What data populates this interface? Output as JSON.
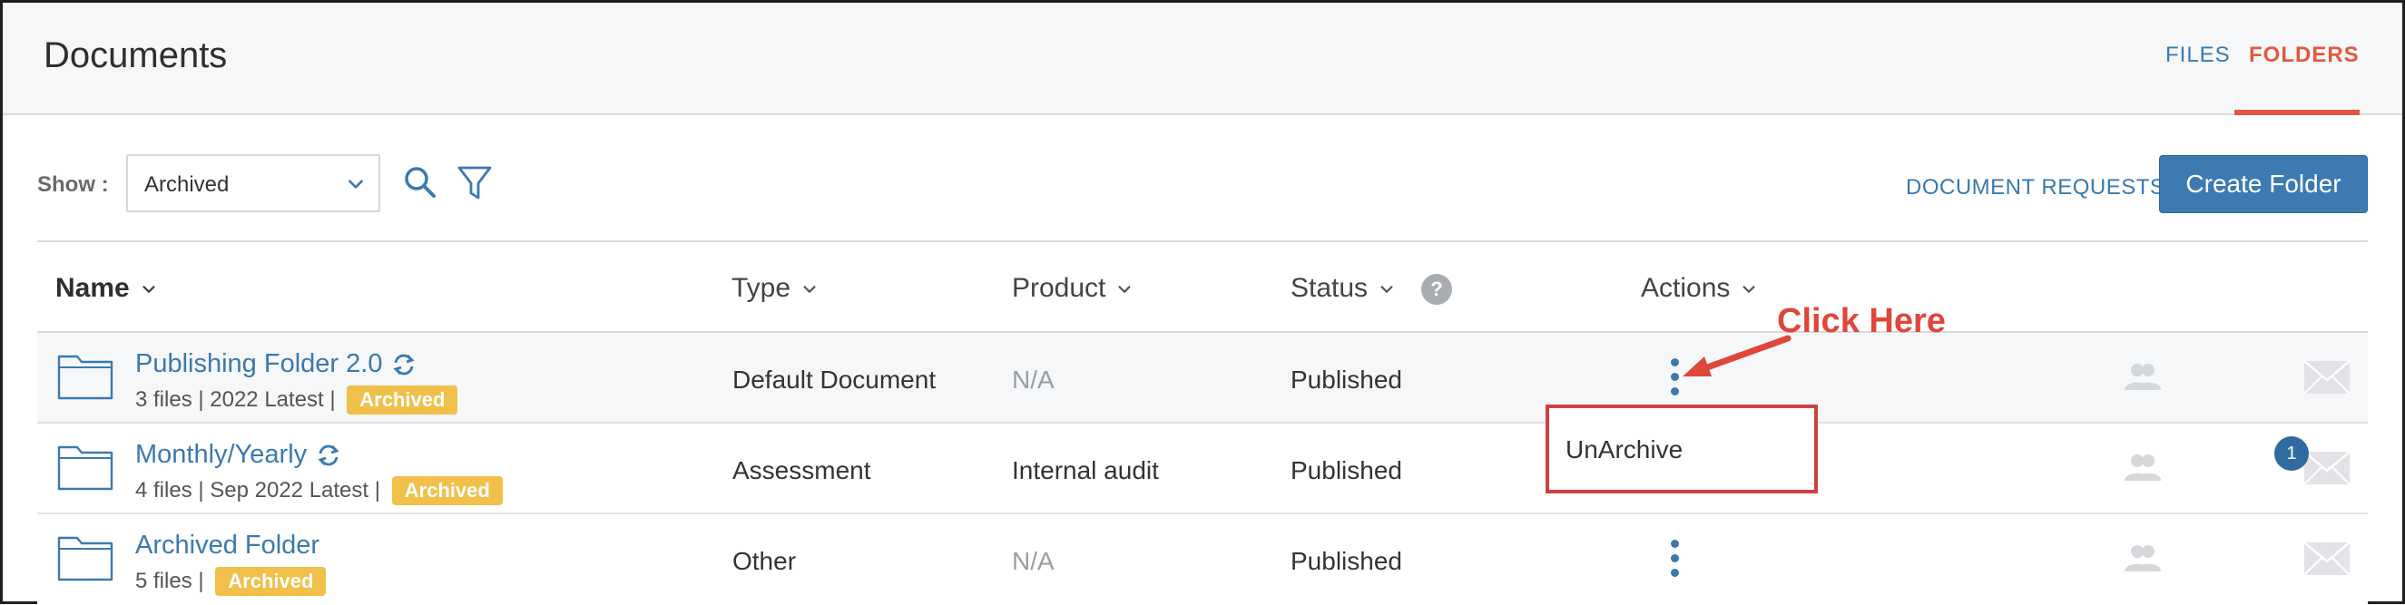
{
  "header": {
    "title": "Documents",
    "tabs": [
      {
        "label": "FILES",
        "active": false
      },
      {
        "label": "FOLDERS",
        "active": true
      }
    ]
  },
  "toolbar": {
    "show_label": "Show :",
    "show_value": "Archived",
    "document_requests": "DOCUMENT REQUESTS",
    "create_folder": "Create Folder"
  },
  "table": {
    "columns": {
      "name": "Name",
      "type": "Type",
      "product": "Product",
      "status": "Status",
      "actions": "Actions",
      "status_help": "?"
    },
    "rows": [
      {
        "name": "Publishing Folder 2.0",
        "meta": "3 files | 2022 Latest |",
        "badge": "Archived",
        "type": "Default Document",
        "product": "N/A",
        "status": "Published"
      },
      {
        "name": "Monthly/Yearly",
        "meta": "4 files | Sep 2022 Latest |",
        "badge": "Archived",
        "type": "Assessment",
        "product": "Internal audit",
        "status": "Published",
        "message_count": "1"
      },
      {
        "name": "Archived Folder",
        "meta": "5 files |",
        "badge": "Archived",
        "type": "Other",
        "product": "N/A",
        "status": "Published"
      }
    ]
  },
  "action_menu": {
    "items": [
      {
        "label": "UnArchive"
      }
    ]
  },
  "annotation": {
    "label": "Click Here",
    "color": "#e0463a"
  },
  "colors": {
    "accent": "#3b79b0",
    "active_tab": "#e2583e",
    "badge": "#f0c04a",
    "button": "#3d7ab2"
  },
  "icons": [
    "search-icon",
    "filter-icon",
    "chevron-down-icon",
    "folder-icon",
    "sync-icon",
    "kebab-menu-icon",
    "users-icon",
    "mail-icon",
    "help-icon"
  ]
}
